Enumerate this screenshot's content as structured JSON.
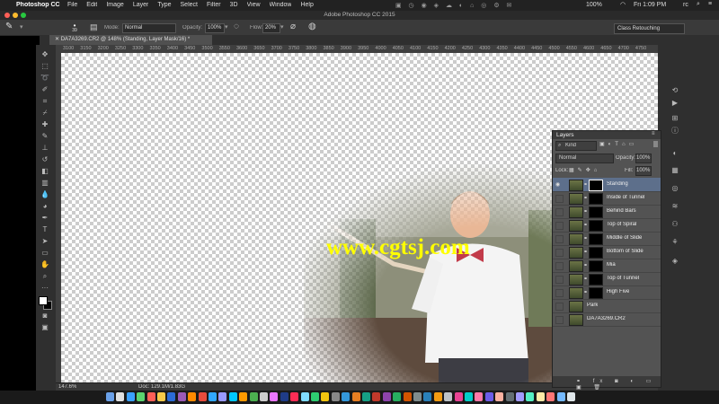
{
  "menubar": {
    "app": "Photoshop CC",
    "items": [
      "File",
      "Edit",
      "Image",
      "Layer",
      "Type",
      "Select",
      "Filter",
      "3D",
      "View",
      "Window",
      "Help"
    ],
    "battery": "100%",
    "clock": "Fri 1:09 PM",
    "user": "rc"
  },
  "title": "Adobe Photoshop CC 2015",
  "options": {
    "brush_size": "39",
    "mode_label": "Mode:",
    "mode_value": "Normal",
    "opacity_label": "Opacity:",
    "opacity_value": "100%",
    "flow_label": "Flow:",
    "flow_value": "20%"
  },
  "workspace": "Class Retouching",
  "doc_tab": "DA7A3269.CR2 @ 148% (Standing, Layer Mask/16) *",
  "ruler_ticks": [
    "3100",
    "3150",
    "3200",
    "3250",
    "3300",
    "3350",
    "3400",
    "3450",
    "3500",
    "3550",
    "3600",
    "3650",
    "3700",
    "3750",
    "3800",
    "3850",
    "3900",
    "3950",
    "4000",
    "4050",
    "4100",
    "4150",
    "4200",
    "4250",
    "4300",
    "4350",
    "4400",
    "4450",
    "4500",
    "4550",
    "4600",
    "4650",
    "4700",
    "4750"
  ],
  "watermark": "www.cgtsj.com",
  "status": {
    "zoom": "147.6%",
    "doc": "Doc: 129.1M/1.83G"
  },
  "layers_panel": {
    "title": "Layers",
    "filter_kind": "Kind",
    "blend": "Normal",
    "opacity_label": "Opacity:",
    "opacity_value": "100%",
    "lock_label": "Lock:",
    "fill_label": "Fill:",
    "fill_value": "100%",
    "layers": [
      {
        "name": "Standing",
        "mask": true,
        "selected": true
      },
      {
        "name": "Inside of Tunnel",
        "mask": true,
        "selected": false
      },
      {
        "name": "Behind Bars",
        "mask": true,
        "selected": false
      },
      {
        "name": "Top of Spiral",
        "mask": true,
        "selected": false
      },
      {
        "name": "Middle of Slide",
        "mask": true,
        "selected": false
      },
      {
        "name": "Bottom of Slide",
        "mask": true,
        "selected": false
      },
      {
        "name": "Mia",
        "mask": true,
        "selected": false
      },
      {
        "name": "Top of Tunnel",
        "mask": true,
        "selected": false
      },
      {
        "name": "High Five",
        "mask": true,
        "selected": false
      },
      {
        "name": "Park",
        "mask": false,
        "selected": false
      },
      {
        "name": "DA7A3269.CR2",
        "mask": false,
        "selected": false
      }
    ]
  },
  "colors": {
    "accent_selected": "#5d6f8b",
    "watermark": "#ffff00"
  }
}
